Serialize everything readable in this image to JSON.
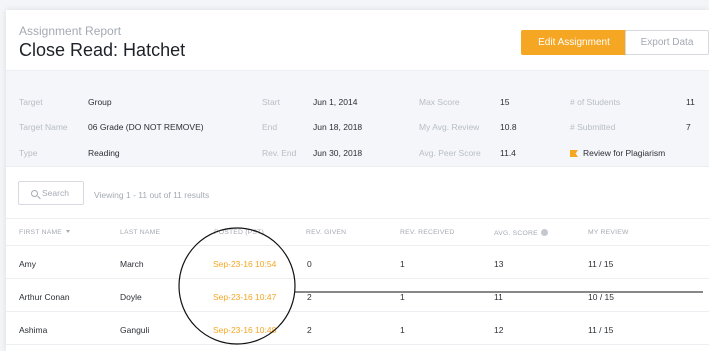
{
  "header": {
    "subtitle": "Assignment Report",
    "title": "Close Read: Hatchet",
    "edit_button": "Edit Assignment",
    "export_button": "Export Data"
  },
  "info": {
    "target_label": "Target",
    "target_value": "Group",
    "target_name_label": "Target Name",
    "target_name_value": "06 Grade (DO NOT REMOVE)",
    "type_label": "Type",
    "type_value": "Reading",
    "start_label": "Start",
    "start_value": "Jun 1, 2014",
    "end_label": "End",
    "end_value": "Jun 18, 2018",
    "rev_end_label": "Rev. End",
    "rev_end_value": "Jun 30, 2018",
    "max_score_label": "Max Score",
    "max_score_value": "15",
    "my_avg_label": "My Avg. Review",
    "my_avg_value": "10.8",
    "avg_peer_label": "Avg. Peer Score",
    "avg_peer_value": "11.4",
    "students_label": "# of Students",
    "students_value": "11",
    "submitted_label": "# Submitted",
    "submitted_value": "7",
    "plagiarism_link": "Review for Plagiarism"
  },
  "toolbar": {
    "search_label": "Search",
    "viewing_text": "Viewing 1 - 11 out of 11 results"
  },
  "table": {
    "headers": [
      "FIRST NAME",
      "LAST NAME",
      "POSTED (PST)",
      "REV. GIVEN",
      "REV. RECEIVED",
      "AVG. SCORE",
      "MY REVIEW"
    ],
    "rows": [
      [
        "Amy",
        "March",
        "Sep-23-16 10:54",
        "0",
        "1",
        "13",
        "11 / 15"
      ],
      [
        "Arthur Conan",
        "Doyle",
        "Sep-23-16 10:47",
        "2",
        "1",
        "11",
        "10 / 15"
      ],
      [
        "Ashima",
        "Ganguli",
        "Sep-23-16 10:48",
        "2",
        "1",
        "12",
        "11 / 15"
      ]
    ]
  },
  "colors": {
    "accent": "#f5a623",
    "muted": "#a4aab3",
    "text": "#2b2f36"
  }
}
